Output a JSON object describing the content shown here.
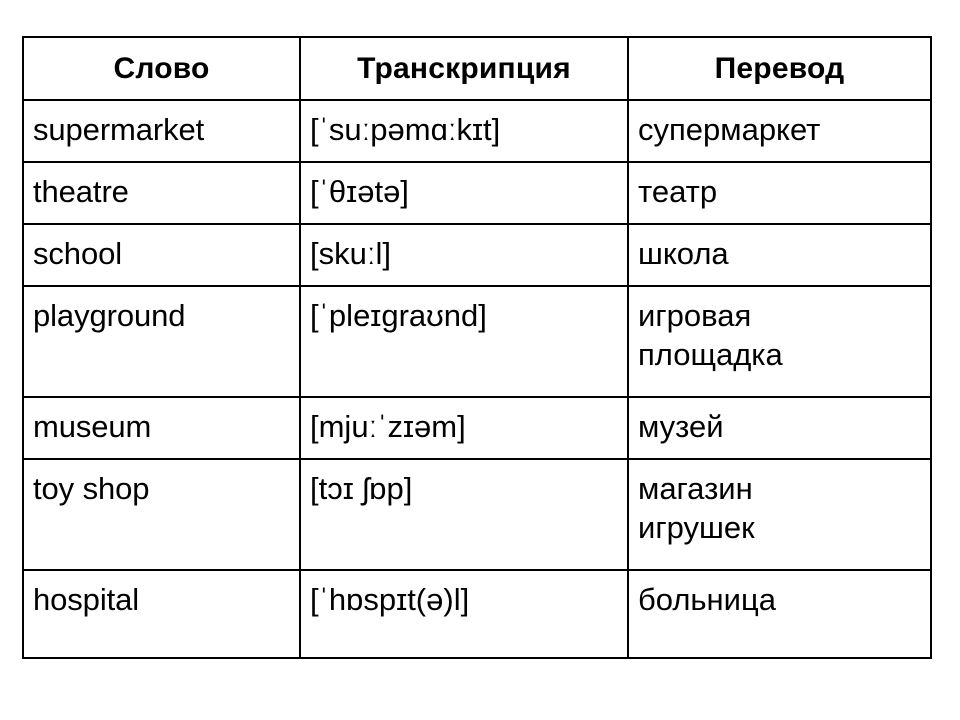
{
  "table": {
    "headers": [
      {
        "label": "Слово"
      },
      {
        "label": "Транскрипция"
      },
      {
        "label": "Перевод"
      }
    ],
    "rows": [
      {
        "word": "supermarket",
        "transcription": "[ˈsuːpəmɑːkɪt]",
        "translation": "супермаркет"
      },
      {
        "word": "theatre",
        "transcription": "[ˈθɪətə]",
        "translation": "театр"
      },
      {
        "word": "school",
        "transcription": "[skuːl]",
        "translation": "школа"
      },
      {
        "word": "playground",
        "transcription": "[ˈpleɪgraʊnd]",
        "translation": "игровая\nплощадка"
      },
      {
        "word": "museum",
        "transcription": "[mjuːˈzɪəm]",
        "translation": "музей"
      },
      {
        "word": "toy shop",
        "transcription": "[tɔɪ ʃɒp]",
        "translation": "магазин\nигрушек"
      },
      {
        "word": "hospital",
        "transcription": "[ˈhɒspɪt(ə)l]",
        "translation": "больница"
      }
    ]
  },
  "colors": {
    "border": "#000000",
    "text": "#000000",
    "background": "#ffffff"
  }
}
